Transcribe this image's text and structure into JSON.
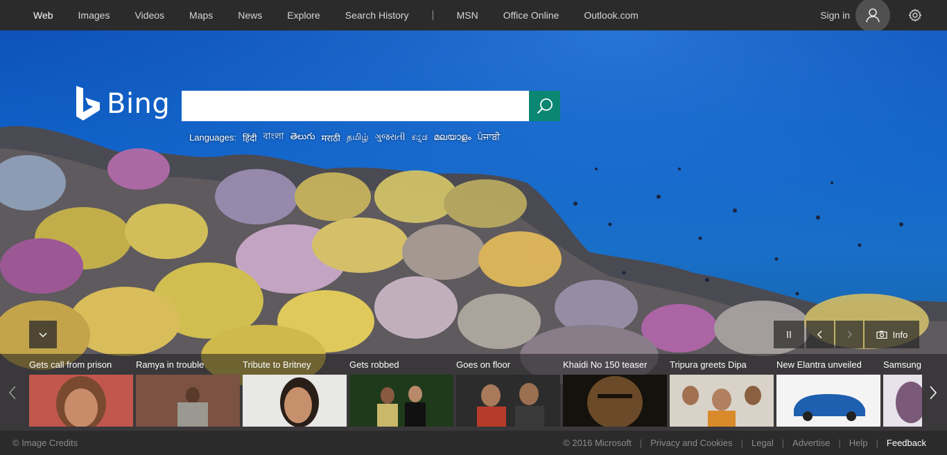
{
  "nav": {
    "items": [
      {
        "label": "Web",
        "active": true
      },
      {
        "label": "Images"
      },
      {
        "label": "Videos"
      },
      {
        "label": "Maps"
      },
      {
        "label": "News"
      },
      {
        "label": "Explore"
      },
      {
        "label": "Search History"
      }
    ],
    "ms_items": [
      {
        "label": "MSN"
      },
      {
        "label": "Office Online"
      },
      {
        "label": "Outlook.com"
      }
    ],
    "sign_in": "Sign in",
    "avatar_icon": "person-icon",
    "settings_icon": "gear-icon"
  },
  "logo": {
    "text": "Bing",
    "icon": "bing-b-icon"
  },
  "search": {
    "value": "",
    "placeholder": "",
    "button_icon": "search-icon",
    "button_color": "#0a8673"
  },
  "languages": {
    "label": "Languages:",
    "links": [
      "हिंदी",
      "বাংলা",
      "తెలుగు",
      "मराठी",
      "தமிழ்",
      "ગુજરાતી",
      "ಕನ್ನಡ",
      "മലയാളം",
      "ਪੰਜਾਬੀ"
    ]
  },
  "hero_controls": {
    "collapse_icon": "chevron-down-icon",
    "pause_icon": "pause-icon",
    "prev_icon": "chevron-left-icon",
    "next_icon": "chevron-right-icon",
    "info_icon": "camera-icon",
    "info_label": "Info"
  },
  "news": [
    {
      "title": "Gets call from prison"
    },
    {
      "title": "Ramya in trouble"
    },
    {
      "title": "Tribute to Britney"
    },
    {
      "title": "Gets robbed"
    },
    {
      "title": "Goes on floor"
    },
    {
      "title": "Khaidi No 150 teaser"
    },
    {
      "title": "Tripura greets Dipa"
    },
    {
      "title": "New Elantra unveiled"
    },
    {
      "title": "Samsung"
    }
  ],
  "footer": {
    "credits": "© Image Credits",
    "links": [
      "© 2016 Microsoft",
      "Privacy and Cookies",
      "Legal",
      "Advertise",
      "Help",
      "Feedback"
    ]
  },
  "colors": {
    "topbar": "#2b2b2b",
    "ocean": "#0f63c9",
    "search_button": "#0a8673"
  }
}
